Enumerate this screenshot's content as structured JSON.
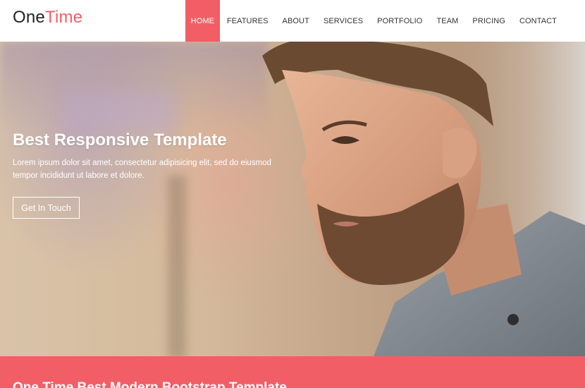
{
  "brand": {
    "part1": "One",
    "part2": "Time"
  },
  "nav": [
    {
      "label": "HOME",
      "active": true
    },
    {
      "label": "FEATURES"
    },
    {
      "label": "ABOUT"
    },
    {
      "label": "SERVICES"
    },
    {
      "label": "PORTFOLIO"
    },
    {
      "label": "TEAM"
    },
    {
      "label": "PRICING"
    },
    {
      "label": "CONTACT"
    }
  ],
  "hero": {
    "title": "Best Responsive Template",
    "description": "Lorem ipsum dolor sit amet, consectetur adipisicing elit, sed do eiusmod tempor incididunt ut labore et dolore.",
    "button_label": "Get In Touch"
  },
  "band": {
    "title": "One Time Best Modern Bootstrap Template"
  },
  "colors": {
    "accent": "#f25e66",
    "text_dark": "#222222"
  }
}
